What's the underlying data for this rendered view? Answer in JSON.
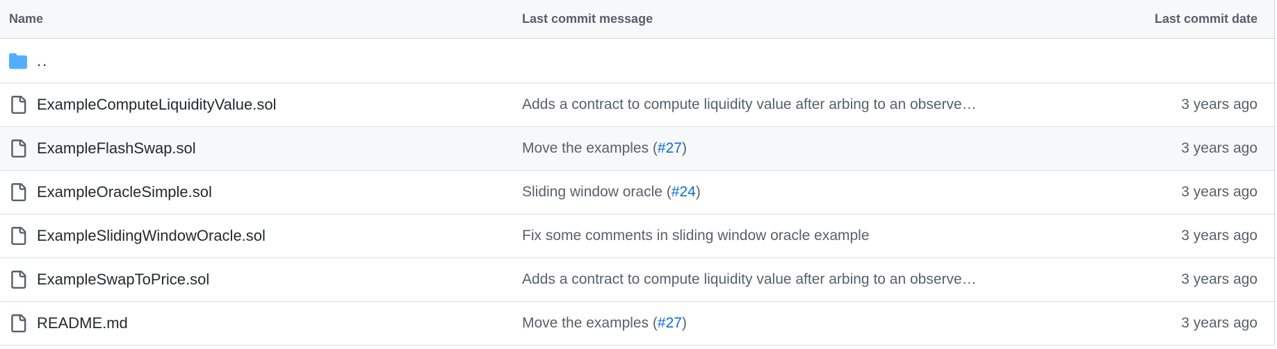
{
  "header": {
    "name": "Name",
    "message": "Last commit message",
    "date": "Last commit date"
  },
  "parent": {
    "label": "..",
    "icon": "folder-icon"
  },
  "files": [
    {
      "name": "ExampleComputeLiquidityValue.sol",
      "msg_text": "Adds a contract to compute liquidity value after arbing to an observe…",
      "pr_open": "",
      "pr": "",
      "pr_close": "",
      "date": "3 years ago",
      "icon": "file-icon"
    },
    {
      "name": "ExampleFlashSwap.sol",
      "msg_text": "Move the examples",
      "pr_open": " (",
      "pr": "#27",
      "pr_close": ")",
      "date": "3 years ago",
      "icon": "file-icon"
    },
    {
      "name": "ExampleOracleSimple.sol",
      "msg_text": "Sliding window oracle",
      "pr_open": " (",
      "pr": "#24",
      "pr_close": ")",
      "date": "3 years ago",
      "icon": "file-icon"
    },
    {
      "name": "ExampleSlidingWindowOracle.sol",
      "msg_text": "Fix some comments in sliding window oracle example",
      "pr_open": "",
      "pr": "",
      "pr_close": "",
      "date": "3 years ago",
      "icon": "file-icon"
    },
    {
      "name": "ExampleSwapToPrice.sol",
      "msg_text": "Adds a contract to compute liquidity value after arbing to an observe…",
      "pr_open": "",
      "pr": "",
      "pr_close": "",
      "date": "3 years ago",
      "icon": "file-icon"
    },
    {
      "name": "README.md",
      "msg_text": "Move the examples",
      "pr_open": " (",
      "pr": "#27",
      "pr_close": ")",
      "date": "3 years ago",
      "icon": "file-icon"
    }
  ],
  "colors": {
    "link": "#0969da",
    "folder": "#54aeff",
    "header_bg": "#f6f8fa"
  }
}
